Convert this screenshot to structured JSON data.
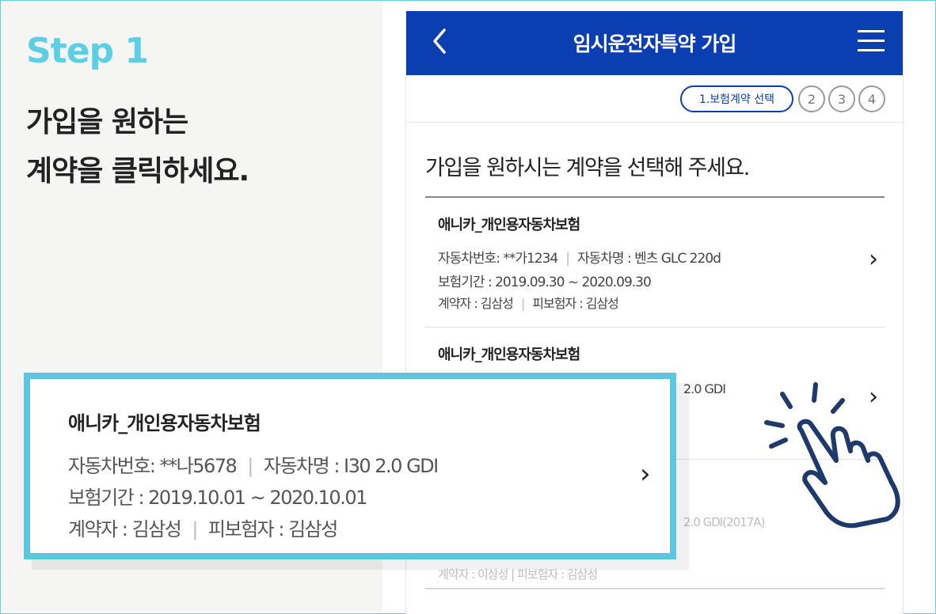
{
  "left": {
    "step_title": "Step 1",
    "instruction_line1": "가입을 원하는",
    "instruction_line2": "계약을 클릭하세요."
  },
  "header": {
    "title": "임시운전자특약 가입",
    "back_icon": "chevron-left-icon",
    "menu_icon": "hamburger-menu-icon"
  },
  "steps": {
    "active_label": "1.보험계약 선택",
    "step2": "2",
    "step3": "3",
    "step4": "4"
  },
  "prompt": "가입을 원하시는 계약을 선택해 주세요.",
  "contracts": [
    {
      "name": "애니카_개인용자동차보험",
      "car_number": "자동차번호: **가1234",
      "car_name": "자동차명 : 벤츠 GLC 220d",
      "period": "보험기간 : 2019.09.30 ~ 2020.09.30",
      "contractor": "계약자 : 김삼성",
      "insured": "피보험자 : 김삼성"
    },
    {
      "name": "애니카_개인용자동차보험",
      "partial_car_name": "2.0 GDI"
    },
    {
      "partial_car_name": "2.0 GDI(2017A)",
      "partial_persons": "계약자 : 이삼성  |  피보험자 : 김삼성"
    }
  ],
  "zoom": {
    "name": "애니카_개인용자동차보험",
    "car_number": "자동차번호: **나5678",
    "car_name": "자동차명 : I30 2.0 GDI",
    "period": "보험기간 : 2019.10.01 ~ 2020.10.01",
    "contractor": "계약자 : 김삼성",
    "insured": "피보험자 : 김삼성",
    "separator": "|"
  },
  "colors": {
    "header_bg": "#0b3fb1",
    "accent_cyan": "#5cc6de",
    "hand_stroke": "#1e3a6b"
  }
}
